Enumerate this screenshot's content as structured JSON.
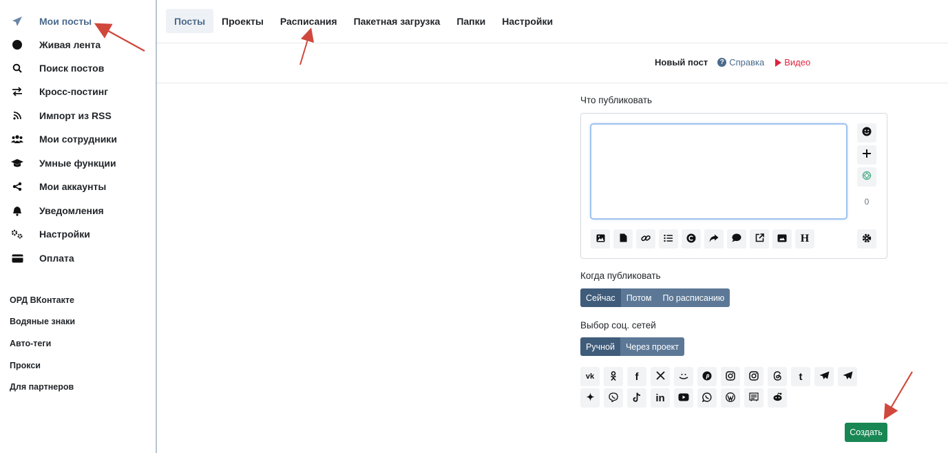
{
  "sidebar": {
    "items": [
      {
        "label": "Мои посты",
        "icon": "paper-plane-icon",
        "active": true
      },
      {
        "label": "Живая лента",
        "icon": "circle-icon"
      },
      {
        "label": "Поиск постов",
        "icon": "search-icon"
      },
      {
        "label": "Кросс-постинг",
        "icon": "exchange-arrows-icon"
      },
      {
        "label": "Импорт из RSS",
        "icon": "rss-icon"
      },
      {
        "label": "Мои сотрудники",
        "icon": "users-icon"
      },
      {
        "label": "Умные функции",
        "icon": "graduation-cap-icon"
      },
      {
        "label": "Мои аккаунты",
        "icon": "share-nodes-icon"
      },
      {
        "label": "Уведомления",
        "icon": "bell-icon"
      },
      {
        "label": "Настройки",
        "icon": "gears-icon"
      },
      {
        "label": "Оплата",
        "icon": "credit-card-icon"
      }
    ],
    "extra_links": [
      "ОРД ВКонтакте",
      "Водяные знаки",
      "Авто-теги",
      "Прокси",
      "Для партнеров"
    ]
  },
  "tabs": [
    {
      "label": "Посты",
      "active": true
    },
    {
      "label": "Проекты"
    },
    {
      "label": "Расписания"
    },
    {
      "label": "Пакетная загрузка"
    },
    {
      "label": "Папки"
    },
    {
      "label": "Настройки"
    }
  ],
  "post": {
    "title": "Новый пост",
    "help_label": "Справка",
    "video_label": "Видео",
    "what_label": "Что публиковать",
    "text_value": "",
    "char_count": "0",
    "side_icons": [
      "emoji-icon",
      "plus-icon",
      "ai-icon"
    ],
    "toolbar_icons": [
      "image-icon",
      "file-icon",
      "link-icon",
      "list-icon",
      "c-circle-icon",
      "forward-icon",
      "comment-icon",
      "external-link-icon",
      "video-card-icon",
      "heading-icon"
    ],
    "settings_icon": "gear-icon",
    "when_label": "Когда публиковать",
    "when_options": [
      {
        "label": "Сейчас",
        "active": true
      },
      {
        "label": "Потом"
      },
      {
        "label": "По расписанию"
      }
    ],
    "network_label": "Выбор соц. сетей",
    "network_modes": [
      {
        "label": "Ручной",
        "active": true
      },
      {
        "label": "Через проект"
      }
    ],
    "social_row1": [
      "vk-icon",
      "odnoklassniki-icon",
      "facebook-icon",
      "x-icon",
      "dzen-icon",
      "pinterest-icon",
      "instagram-icon",
      "instagram-business-icon",
      "threads-icon",
      "tumblr-icon",
      "telegram-icon",
      "telegram-bot-icon"
    ],
    "social_row2": [
      "sparkle-icon",
      "viber-icon",
      "tiktok-icon",
      "linkedin-icon",
      "youtube-icon",
      "whatsapp-icon",
      "wordpress-icon",
      "news-icon",
      "reddit-icon"
    ],
    "create_label": "Создать"
  },
  "colors": {
    "accent": "#4a6a8c",
    "segment_active": "#3f5c7a",
    "segment": "#5c7896",
    "create": "#198754",
    "video": "#e0233d",
    "annotation_arrow": "#d0473c"
  }
}
